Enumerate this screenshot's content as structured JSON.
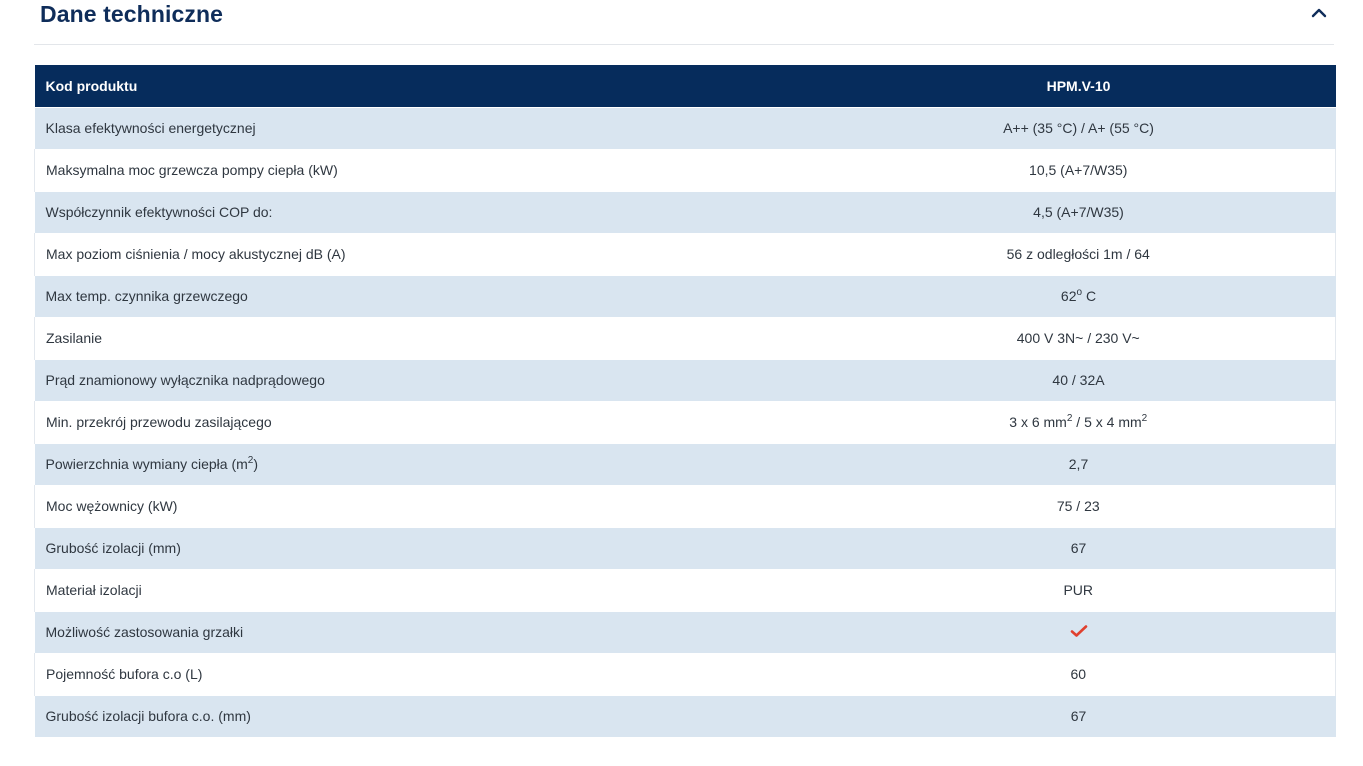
{
  "section": {
    "title": "Dane techniczne",
    "toggle_icon": "chevron-up-icon"
  },
  "table": {
    "header": {
      "label": "Kod produktu",
      "value": "HPM.V-10"
    },
    "rows": [
      {
        "label": "Klasa efektywności energetycznej",
        "value": "A++ (35 °C) / A+ (55 °C)"
      },
      {
        "label": "Maksymalna moc grzewcza pompy ciepła (kW)",
        "value": "10,5 (A+7/W35)"
      },
      {
        "label": "Współczynnik efektywności COP do:",
        "value": "4,5 (A+7/W35)"
      },
      {
        "label": "Max poziom ciśnienia / mocy akustycznej dB (A)",
        "value": "56 z odległości 1m / 64"
      },
      {
        "label": "Max temp. czynnika grzewczego",
        "value_main": "62",
        "value_sup": "o",
        "value_tail": " C"
      },
      {
        "label": "Zasilanie",
        "value": "400 V 3N~ / 230 V~"
      },
      {
        "label": "Prąd znamionowy wyłącznika nadprądowego",
        "value": "40 / 32A"
      },
      {
        "label": "Min. przekrój przewodu zasilającego",
        "value_a": "3 x 6 mm",
        "value_a_sup": "2",
        "value_b": " / 5 x 4 mm",
        "value_b_sup": "2"
      },
      {
        "label_main": "Powierzchnia wymiany ciepła (m",
        "label_sup": "2",
        "label_tail": ")",
        "value": "2,7"
      },
      {
        "label": "Moc wężownicy (kW)",
        "value": "75 / 23"
      },
      {
        "label": "Grubość izolacji (mm)",
        "value": "67"
      },
      {
        "label": "Materiał izolacji",
        "value": "PUR"
      },
      {
        "label": "Możliwość zastosowania grzałki",
        "value_icon": "checkmark-icon",
        "check_color": "#e0402e"
      },
      {
        "label": "Pojemność bufora c.o (L)",
        "value": "60"
      },
      {
        "label": "Grubość izolacji bufora c.o. (mm)",
        "value": "67"
      }
    ]
  },
  "colors": {
    "title": "#0f2d5a",
    "header_bg": "#062c5c",
    "row_alt_bg": "#d9e5f0",
    "check": "#e0402e"
  }
}
